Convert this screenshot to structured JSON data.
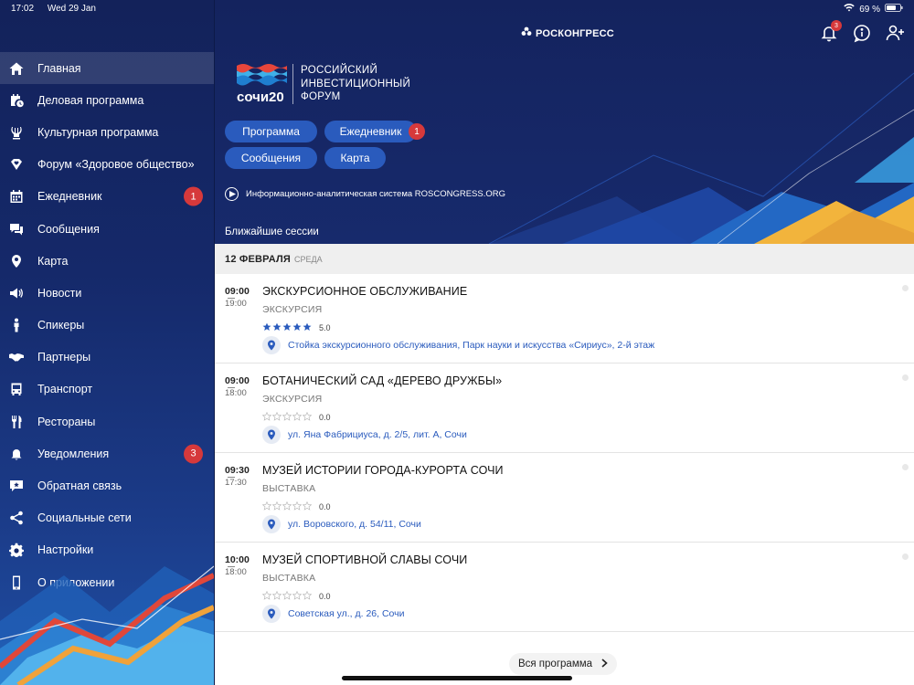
{
  "status": {
    "time": "17:02",
    "date": "Wed 29 Jan",
    "battery": "69 %"
  },
  "sidebar": {
    "items": [
      {
        "label": "Главная",
        "icon": "home-icon",
        "active": true
      },
      {
        "label": "Деловая программа",
        "icon": "calendar-clock-icon"
      },
      {
        "label": "Культурная программа",
        "icon": "lyre-icon"
      },
      {
        "label": "Форум «Здоровое общество»",
        "icon": "heart-diamond-icon"
      },
      {
        "label": "Ежедневник",
        "icon": "calendar-icon",
        "badge": "1"
      },
      {
        "label": "Сообщения",
        "icon": "chat-icon"
      },
      {
        "label": "Карта",
        "icon": "map-pin-icon"
      },
      {
        "label": "Новости",
        "icon": "megaphone-icon"
      },
      {
        "label": "Спикеры",
        "icon": "speaker-person-icon"
      },
      {
        "label": "Партнеры",
        "icon": "handshake-icon"
      },
      {
        "label": "Транспорт",
        "icon": "bus-icon"
      },
      {
        "label": "Рестораны",
        "icon": "cutlery-icon"
      },
      {
        "label": "Уведомления",
        "icon": "bell-icon",
        "badge": "3"
      },
      {
        "label": "Обратная связь",
        "icon": "feedback-icon"
      },
      {
        "label": "Социальные сети",
        "icon": "share-icon"
      },
      {
        "label": "Настройки",
        "icon": "gear-icon"
      },
      {
        "label": "О приложении",
        "icon": "phone-icon"
      }
    ]
  },
  "header": {
    "brand": "РОСКОНГРЕСС",
    "notifications_count": "3",
    "logo_word": "сочи20",
    "logo_lines": [
      "РОССИЙСКИЙ",
      "ИНВЕСТИЦИОННЫЙ",
      "ФОРУМ"
    ]
  },
  "quick_links": [
    {
      "label": "Программа"
    },
    {
      "label": "Ежедневник",
      "badge": "1"
    },
    {
      "label": "Сообщения"
    },
    {
      "label": "Карта"
    }
  ],
  "info_link": "Информационно-аналитическая система ROSCONGRESS.ORG",
  "section_title": "Ближайшие сессии",
  "date_header": {
    "date": "12 ФЕВРАЛЯ",
    "weekday": "СРЕДА"
  },
  "sessions": [
    {
      "start": "09:00",
      "end": "19:00",
      "title": "ЭКСКУРСИОННОЕ ОБСЛУЖИВАНИЕ",
      "type": "ЭКСКУРСИЯ",
      "rating": "5.0",
      "stars": 5,
      "location": "Стойка экскурсионного обслуживания, Парк науки и искусства «Сириус», 2-й этаж"
    },
    {
      "start": "09:00",
      "end": "18:00",
      "title": "БОТАНИЧЕСКИЙ САД «ДЕРЕВО ДРУЖБЫ»",
      "type": "ЭКСКУРСИЯ",
      "rating": "0.0",
      "stars": 0,
      "location": "ул. Яна Фабрициуса, д. 2/5, лит. А, Сочи"
    },
    {
      "start": "09:30",
      "end": "17:30",
      "title": "МУЗЕЙ ИСТОРИИ ГОРОДА-КУРОРТА СОЧИ",
      "type": "ВЫСТАВКА",
      "rating": "0.0",
      "stars": 0,
      "location": "ул. Воровского, д. 54/11, Сочи"
    },
    {
      "start": "10:00",
      "end": "18:00",
      "title": "МУЗЕЙ СПОРТИВНОЙ СЛАВЫ СОЧИ",
      "type": "ВЫСТАВКА",
      "rating": "0.0",
      "stars": 0,
      "location": "Советская ул., д. 26, Сочи"
    }
  ],
  "all_program": "Вся программа",
  "colors": {
    "navy": "#14235e",
    "accent_blue": "#2a5bbd",
    "badge_red": "#d6393b",
    "star_blue": "#2a5bbd"
  }
}
